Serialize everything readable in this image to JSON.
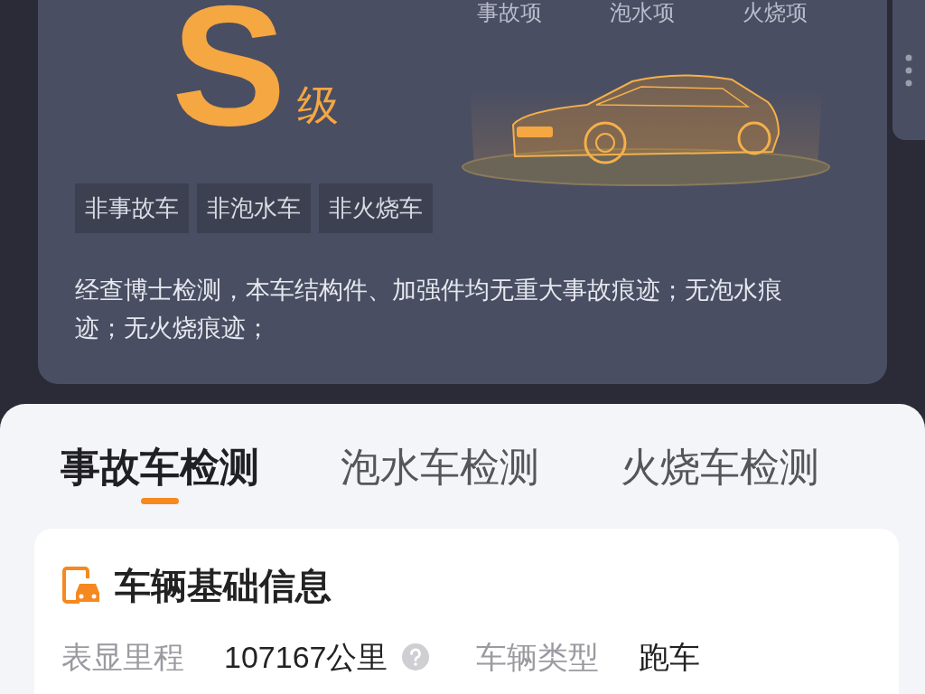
{
  "grade": {
    "letter": "S",
    "suffix": "级"
  },
  "check_items": [
    "事故项",
    "泡水项",
    "火烧项"
  ],
  "tags": [
    "非事故车",
    "非泡水车",
    "非火烧车"
  ],
  "summary": "经查博士检测，本车结构件、加强件均无重大事故痕迹；无泡水痕迹；无火烧痕迹；",
  "tabs": [
    {
      "label": "事故车检测",
      "selected": true
    },
    {
      "label": "泡水车检测",
      "selected": false
    },
    {
      "label": "火烧车检测",
      "selected": false
    }
  ],
  "section": {
    "title": "车辆基础信息"
  },
  "fields": [
    {
      "label": "表显里程",
      "value": "107167公里",
      "help": true
    },
    {
      "label": "车辆类型",
      "value": "跑车",
      "help": false
    }
  ]
}
